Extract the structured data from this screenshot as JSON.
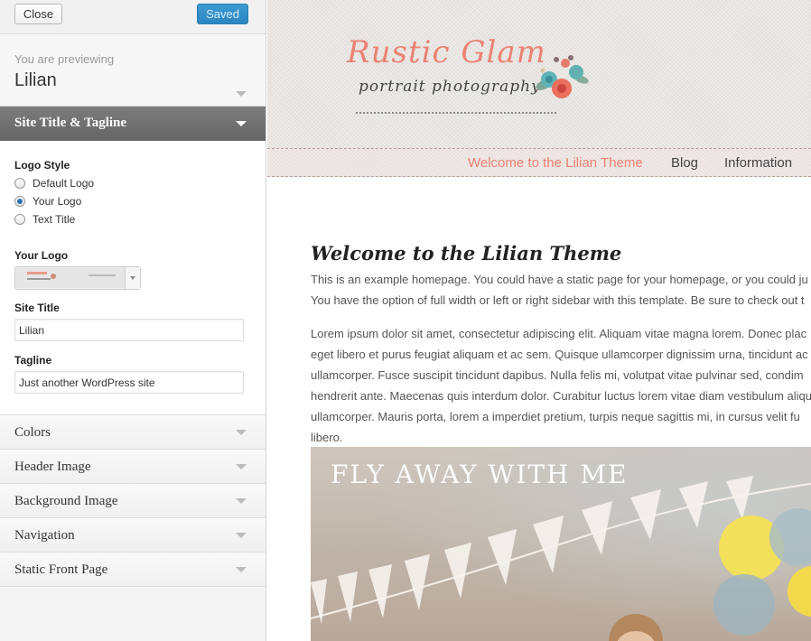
{
  "topbar": {
    "close_label": "Close",
    "saved_label": "Saved"
  },
  "previewing": {
    "label": "You are previewing",
    "theme_name": "Lilian"
  },
  "section": {
    "title": "Site Title & Tagline",
    "logo_style_label": "Logo Style",
    "logo_style_options": [
      "Default Logo",
      "Your Logo",
      "Text Title"
    ],
    "logo_style_selected": "Your Logo",
    "your_logo_label": "Your Logo",
    "site_title_label": "Site Title",
    "site_title_value": "Lilian",
    "tagline_label": "Tagline",
    "tagline_value": "Just another WordPress site"
  },
  "accordion": [
    "Colors",
    "Header Image",
    "Background Image",
    "Navigation",
    "Static Front Page"
  ],
  "preview": {
    "logo_title": "Rustic Glam",
    "logo_subtitle": "portrait photography",
    "nav": [
      "Welcome to the Lilian Theme",
      "Blog",
      "Information"
    ],
    "nav_active_color": "#ec8273",
    "heading": "Welcome to the Lilian Theme",
    "intro_lines": [
      "This is an example homepage. You could have a static page for your homepage, or you could ju",
      "You have the option of full width or left or right sidebar with this template. Be sure to check out t"
    ],
    "lorem_lines": [
      "Lorem ipsum dolor sit amet, consectetur adipiscing elit. Aliquam vitae magna lorem. Donec plac",
      "eget libero et purus feugiat aliquam et ac sem. Quisque ullamcorper dignissim urna, tincidunt ac",
      "ullamcorper. Fusce suscipit tincidunt dapibus. Nulla felis mi, volutpat vitae pulvinar sed, condim",
      "hendrerit ante. Maecenas quis interdum dolor. Curabitur luctus lorem vitae diam vestibulum aliqu",
      "ullamcorper. Mauris porta, lorem a imperdiet pretium, turpis neque sagittis mi, in cursus velit fu",
      "libero."
    ],
    "hero_title": "FLY AWAY WITH ME"
  }
}
